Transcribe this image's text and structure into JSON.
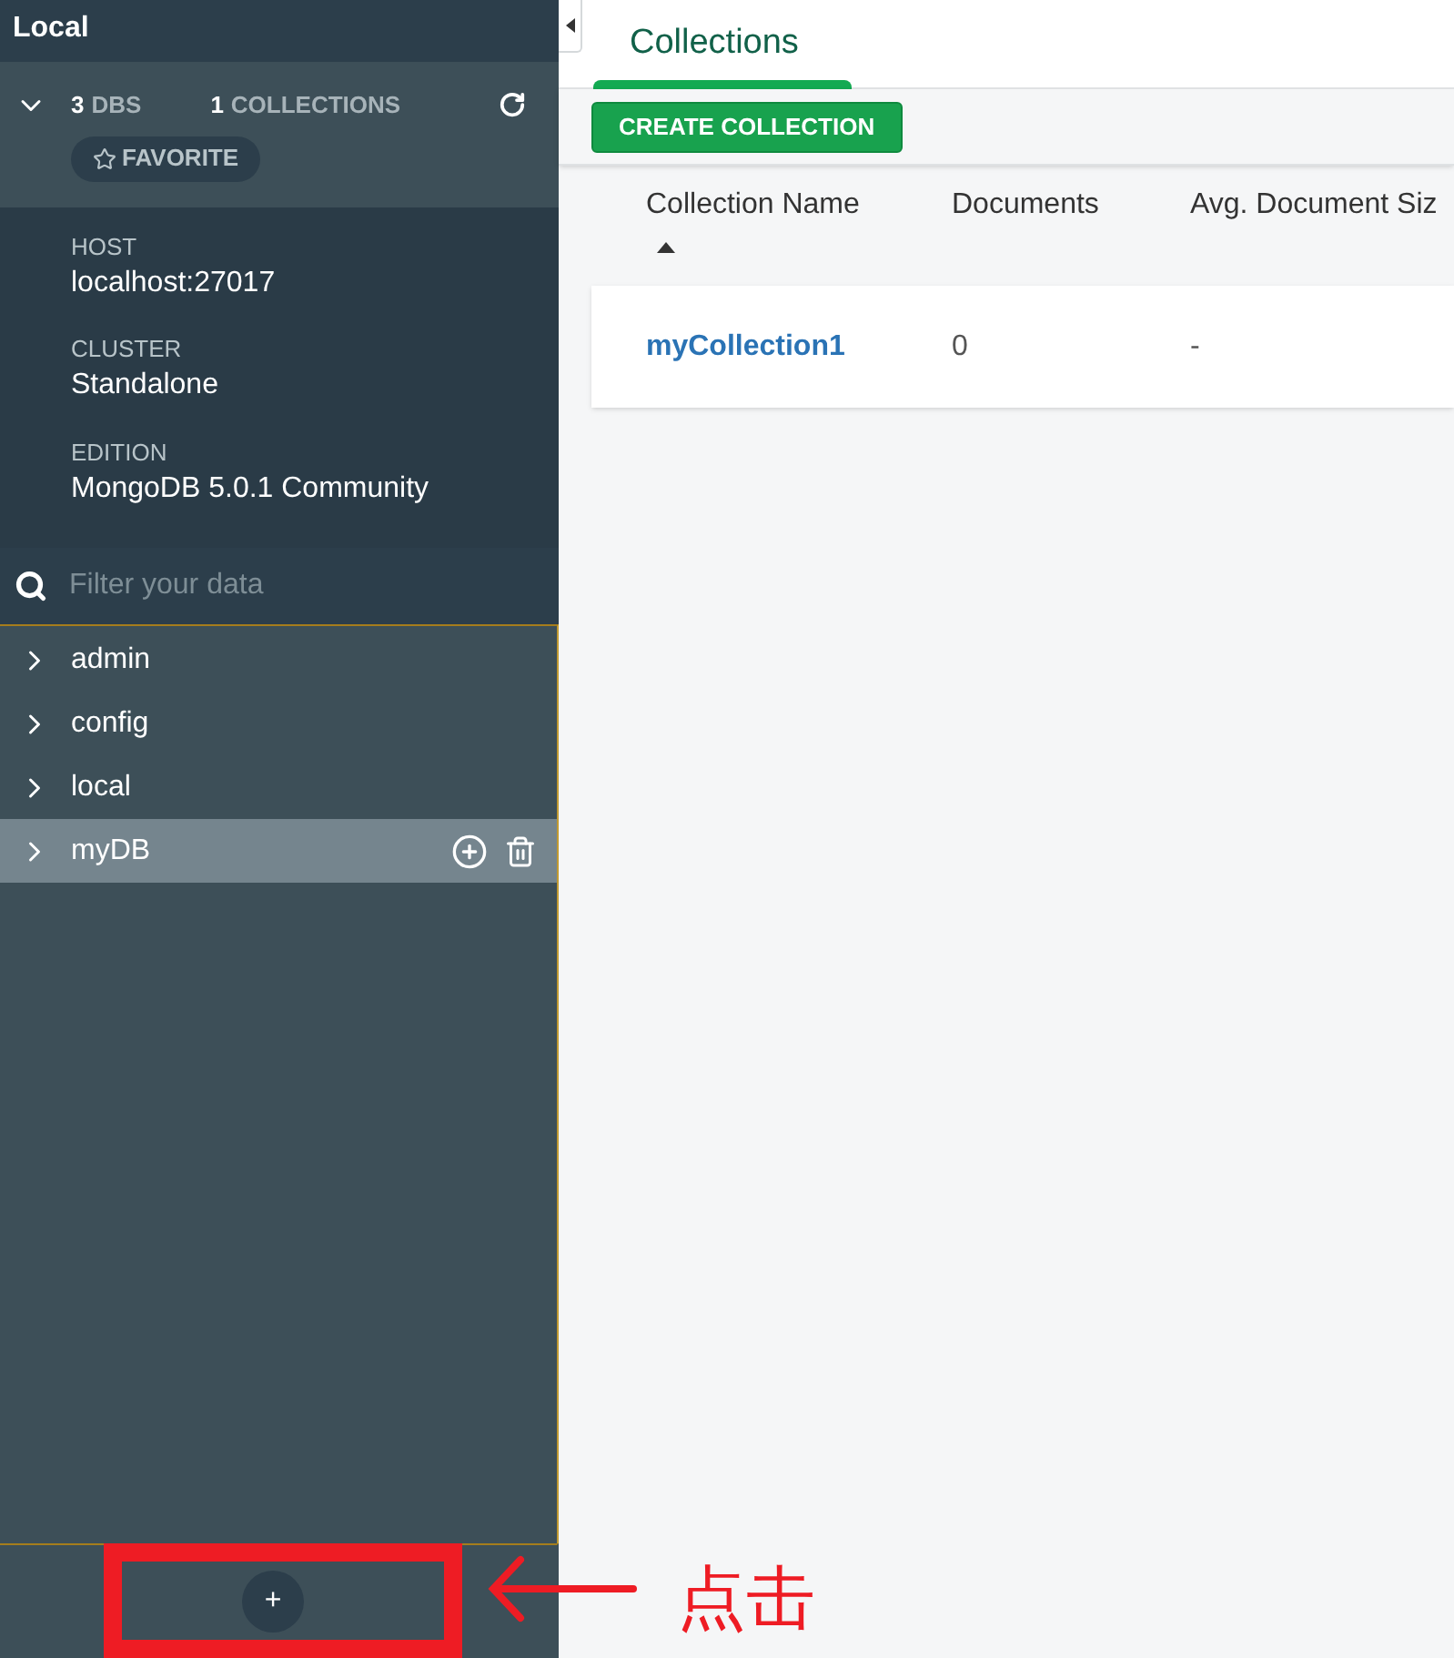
{
  "sidebar": {
    "title": "Local",
    "stats": {
      "dbs_count": "3",
      "dbs_label": "DBS",
      "collections_count": "1",
      "collections_label": "COLLECTIONS",
      "favorite": "FAVORITE"
    },
    "info": [
      {
        "label": "HOST",
        "value": "localhost:27017"
      },
      {
        "label": "CLUSTER",
        "value": "Standalone"
      },
      {
        "label": "EDITION",
        "value": "MongoDB 5.0.1 Community"
      }
    ],
    "filter": {
      "placeholder": "Filter your data"
    },
    "databases": [
      {
        "name": "admin",
        "selected": false
      },
      {
        "name": "config",
        "selected": false
      },
      {
        "name": "local",
        "selected": false
      },
      {
        "name": "myDB",
        "selected": true
      }
    ],
    "add_button": "+"
  },
  "main": {
    "tabs": [
      {
        "label": "Collections",
        "selected": true
      }
    ],
    "create_button": "CREATE COLLECTION",
    "table": {
      "columns": [
        "Collection Name",
        "Documents",
        "Avg. Document Siz"
      ],
      "rows": [
        [
          "myCollection1",
          "0",
          "-"
        ]
      ]
    }
  },
  "annotation": {
    "text": "点击"
  }
}
